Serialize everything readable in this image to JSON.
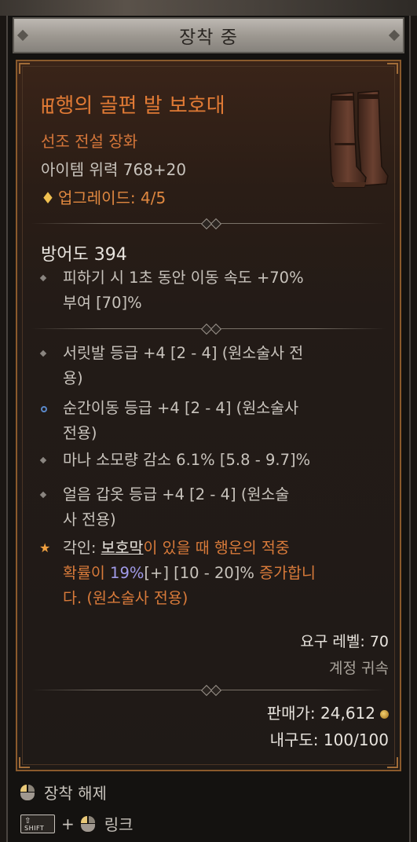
{
  "header": {
    "title": "장착 중"
  },
  "item": {
    "name": "ꡅ행의 골편 발 보호대",
    "type": "선조 전설 장화",
    "power": "아이템 위력 768+20",
    "upgrade": "업그레이드: 4/5",
    "armor": "방어도 394"
  },
  "affixes": {
    "implicit": {
      "line1": "피하기 시 1초 동안 이동 속도 +70%",
      "line2": "부여 [70]%"
    },
    "a1": {
      "line1": "서릿발 등급 +4 [2 - 4] (원소술사 전",
      "line2": "용)"
    },
    "a2": {
      "line1": "순간이동 등급 +4 [2 - 4] (원소술사",
      "line2": "전용)"
    },
    "a3": {
      "line1": "마나 소모량 감소 6.1% [5.8 - 9.7]%"
    },
    "a4": {
      "line1": "얼음 갑옷 등급 +4 [2 - 4] (원소술",
      "line2": "사 전용)"
    }
  },
  "aspect": {
    "prefix": "각인: ",
    "keyword": "보호막",
    "mid1": "이 있을 때 행운의 적중",
    "mid2": "확률이 ",
    "value": "19%",
    "tail": "[+] [10 - 20]%",
    "end": " 증가합니",
    "line3": "다. (원소술사 전용)"
  },
  "requirements": {
    "level": "요구 레벨: 70",
    "binding": "계정 귀속"
  },
  "values": {
    "sell": "판매가: 24,612",
    "durability": "내구도: 100/100"
  },
  "actions": {
    "unequip": "장착 해제",
    "link": "링크",
    "shift_key": "SHIFT",
    "plus": "+"
  },
  "colors": {
    "legendary": "#e07a35",
    "affix": "#c8c3bc",
    "aspect": "#d87a3a",
    "accent_blue": "#5a88c8"
  }
}
